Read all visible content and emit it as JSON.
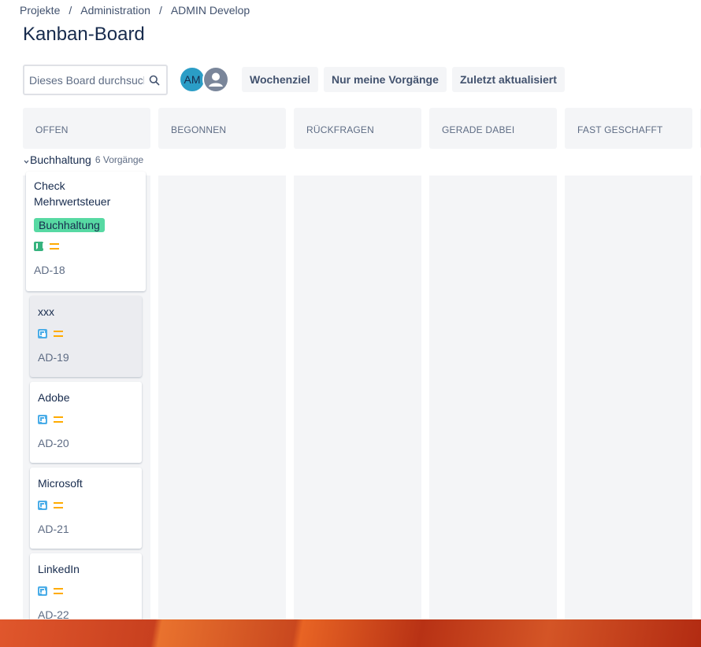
{
  "breadcrumb": [
    "Projekte",
    "Administration",
    "ADMIN Develop"
  ],
  "page_title": "Kanban-Board",
  "search": {
    "placeholder": "Dieses Board durchsuchen"
  },
  "avatars": {
    "initials": "AM"
  },
  "filters": [
    "Wochenziel",
    "Nur meine Vorgänge",
    "Zuletzt aktualisiert"
  ],
  "columns": [
    "OFFEN",
    "BEGONNEN",
    "RÜCKFRAGEN",
    "GERADE DABEI",
    "FAST GESCHAFFT"
  ],
  "swimlane": {
    "name": "Buchhaltung",
    "count": "6 Vorgänge"
  },
  "cards": [
    {
      "title": "Check Mehrwertsteuer",
      "label": "Buchhaltung",
      "type": "story-icon",
      "priority": "medium",
      "key": "AD-18"
    },
    {
      "title": "xxx",
      "type": "subtask-icon",
      "priority": "medium",
      "key": "AD-19"
    },
    {
      "title": "Adobe",
      "type": "subtask-icon",
      "priority": "medium",
      "key": "AD-20"
    },
    {
      "title": "Microsoft",
      "type": "subtask-icon",
      "priority": "medium",
      "key": "AD-21"
    },
    {
      "title": "LinkedIn",
      "type": "subtask-icon",
      "priority": "medium",
      "key": "AD-22"
    }
  ],
  "colors": {
    "label_bg": "#57d9a3",
    "priority": "#ffab00",
    "story": "#36b37e",
    "subtask": "#4bade8",
    "avatar": "#2b9dc6"
  }
}
